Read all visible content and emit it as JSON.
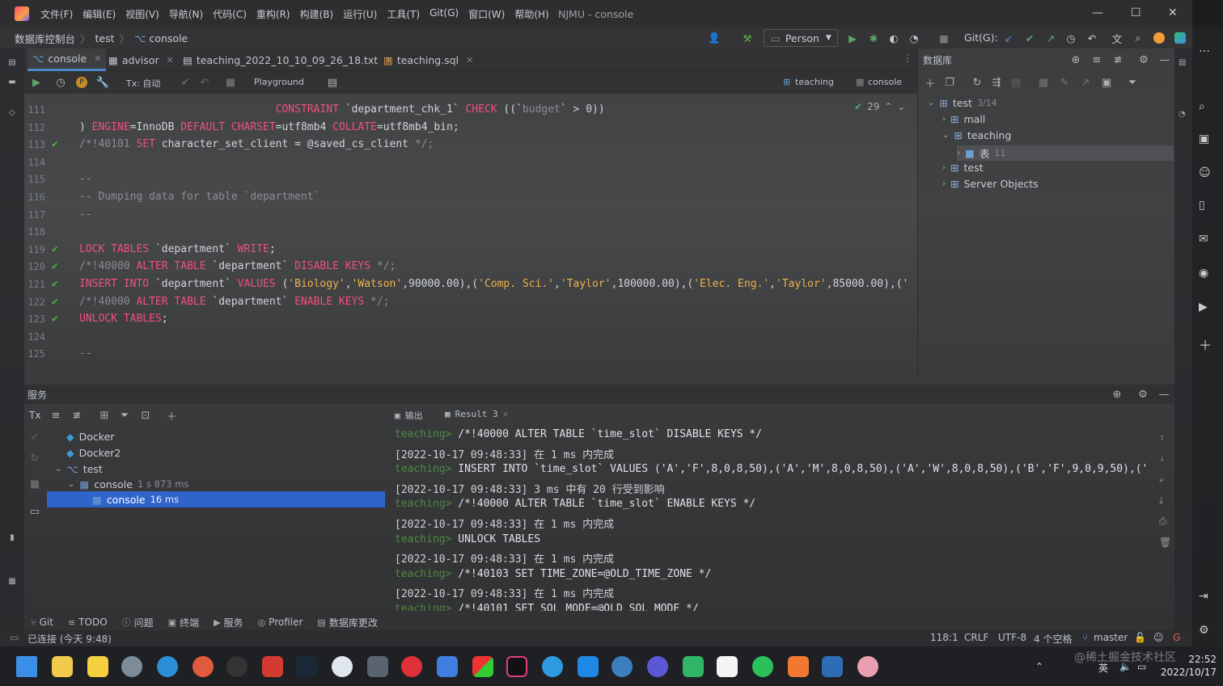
{
  "window": {
    "title": "NJMU - console"
  },
  "menu": [
    "文件(F)",
    "编辑(E)",
    "视图(V)",
    "导航(N)",
    "代码(C)",
    "重构(R)",
    "构建(B)",
    "运行(U)",
    "工具(T)",
    "Git(G)",
    "窗口(W)",
    "帮助(H)"
  ],
  "breadcrumb": {
    "root": "数据库控制台",
    "db": "test",
    "file": "console"
  },
  "toolbar": {
    "run_config": "Person",
    "git_label": "Git(G):"
  },
  "tabs": [
    {
      "label": "console"
    },
    {
      "label": "advisor"
    },
    {
      "label": "teaching_2022_10_10_09_26_18.txt"
    },
    {
      "label": "teaching.sql"
    }
  ],
  "editor_toolbar": {
    "tx": "Tx: 自动",
    "playground": "Playground",
    "schema": "teaching",
    "session": "console"
  },
  "inspection": {
    "count": "29"
  },
  "code": {
    "lines": [
      {
        "n": "111",
        "chk": false,
        "parts": [
          {
            "t": "                               ",
            "c": ""
          },
          {
            "t": "CONSTRAINT",
            "c": "kw"
          },
          {
            "t": " `department_chk_1` ",
            "c": ""
          },
          {
            "t": "CHECK",
            "c": "kw"
          },
          {
            "t": " ((`",
            "c": ""
          },
          {
            "t": "budget",
            "c": "com"
          },
          {
            "t": "` > 0))",
            "c": ""
          }
        ]
      },
      {
        "n": "112",
        "chk": false,
        "parts": [
          {
            "t": ") ",
            "c": ""
          },
          {
            "t": "ENGINE",
            "c": "kw"
          },
          {
            "t": "=InnoDB ",
            "c": ""
          },
          {
            "t": "DEFAULT CHARSET",
            "c": "kw"
          },
          {
            "t": "=utf8mb4 ",
            "c": ""
          },
          {
            "t": "COLLATE",
            "c": "kw"
          },
          {
            "t": "=utf8mb4_bin;",
            "c": ""
          }
        ]
      },
      {
        "n": "113",
        "chk": true,
        "parts": [
          {
            "t": "/*!40101 ",
            "c": "com"
          },
          {
            "t": "SET",
            "c": "kw"
          },
          {
            "t": " character_set_client = @saved_cs_client ",
            "c": ""
          },
          {
            "t": "*/;",
            "c": "com"
          }
        ]
      },
      {
        "n": "114",
        "chk": false,
        "parts": []
      },
      {
        "n": "115",
        "chk": false,
        "parts": [
          {
            "t": "--",
            "c": "com"
          }
        ]
      },
      {
        "n": "116",
        "chk": false,
        "parts": [
          {
            "t": "-- Dumping data for table `department`",
            "c": "com"
          }
        ]
      },
      {
        "n": "117",
        "chk": false,
        "parts": [
          {
            "t": "--",
            "c": "com"
          }
        ]
      },
      {
        "n": "118",
        "chk": false,
        "parts": []
      },
      {
        "n": "119",
        "chk": true,
        "parts": [
          {
            "t": "LOCK TABLES",
            "c": "kw"
          },
          {
            "t": " `department` ",
            "c": ""
          },
          {
            "t": "WRITE",
            "c": "kw"
          },
          {
            "t": ";",
            "c": ""
          }
        ]
      },
      {
        "n": "120",
        "chk": true,
        "parts": [
          {
            "t": "/*!40000 ",
            "c": "com"
          },
          {
            "t": "ALTER TABLE",
            "c": "kw"
          },
          {
            "t": " `department` ",
            "c": ""
          },
          {
            "t": "DISABLE KEYS",
            "c": "kw"
          },
          {
            "t": " */;",
            "c": "com"
          }
        ]
      },
      {
        "n": "121",
        "chk": true,
        "parts": [
          {
            "t": "INSERT INTO",
            "c": "kw"
          },
          {
            "t": " `department` ",
            "c": ""
          },
          {
            "t": "VALUES",
            "c": "kw"
          },
          {
            "t": " (",
            "c": ""
          },
          {
            "t": "'Biology'",
            "c": "str"
          },
          {
            "t": ",",
            "c": ""
          },
          {
            "t": "'Watson'",
            "c": "str"
          },
          {
            "t": ",90000.00),(",
            "c": ""
          },
          {
            "t": "'Comp. Sci.'",
            "c": "str"
          },
          {
            "t": ",",
            "c": ""
          },
          {
            "t": "'Taylor'",
            "c": "str"
          },
          {
            "t": ",100000.00),(",
            "c": ""
          },
          {
            "t": "'Elec. Eng.'",
            "c": "str"
          },
          {
            "t": ",",
            "c": ""
          },
          {
            "t": "'Taylor'",
            "c": "str"
          },
          {
            "t": ",85000.00),('",
            "c": ""
          }
        ]
      },
      {
        "n": "122",
        "chk": true,
        "parts": [
          {
            "t": "/*!40000 ",
            "c": "com"
          },
          {
            "t": "ALTER TABLE",
            "c": "kw"
          },
          {
            "t": " `department` ",
            "c": ""
          },
          {
            "t": "ENABLE KEYS",
            "c": "kw"
          },
          {
            "t": " */;",
            "c": "com"
          }
        ]
      },
      {
        "n": "123",
        "chk": true,
        "parts": [
          {
            "t": "UNLOCK TABLES",
            "c": "kw"
          },
          {
            "t": ";",
            "c": ""
          }
        ]
      },
      {
        "n": "124",
        "chk": false,
        "parts": []
      },
      {
        "n": "125",
        "chk": false,
        "parts": [
          {
            "t": "--",
            "c": "com"
          }
        ]
      }
    ]
  },
  "db_panel": {
    "title": "数据库",
    "tree": [
      {
        "label": "test",
        "extra": "3/14",
        "level": 0,
        "arrow": "v"
      },
      {
        "label": "mall",
        "extra": "",
        "level": 1,
        "arrow": ">"
      },
      {
        "label": "teaching",
        "extra": "",
        "level": 1,
        "arrow": "v"
      },
      {
        "label": "表",
        "extra": "11",
        "level": 2,
        "arrow": ">"
      },
      {
        "label": "test",
        "extra": "",
        "level": 1,
        "arrow": ">"
      },
      {
        "label": "Server Objects",
        "extra": "",
        "level": 1,
        "arrow": ">"
      }
    ]
  },
  "services": {
    "title": "服务",
    "tx": "Tx",
    "tree": [
      {
        "label": "Docker",
        "extra": "",
        "level": 1
      },
      {
        "label": "Docker2",
        "extra": "",
        "level": 1
      },
      {
        "label": "test",
        "extra": "",
        "level": 1
      },
      {
        "label": "console",
        "extra": "1 s 873 ms",
        "level": 2
      },
      {
        "label": "console",
        "extra": "16 ms",
        "level": 3
      }
    ],
    "output_tabs": [
      "输出",
      "Result 3"
    ],
    "output": [
      {
        "prompt": "teaching>",
        "text": " /*!40000 ALTER TABLE `time_slot` DISABLE KEYS */"
      },
      {
        "prompt": "",
        "text": "[2022-10-17 09:48:33] 在 1 ms 内完成"
      },
      {
        "prompt": "teaching>",
        "text": " INSERT INTO `time_slot` VALUES ('A','F',8,0,8,50),('A','M',8,0,8,50),('A','W',8,0,8,50),('B','F',9,0,9,50),('"
      },
      {
        "prompt": "",
        "text": "[2022-10-17 09:48:33] 3 ms 中有 20 行受到影响"
      },
      {
        "prompt": "teaching>",
        "text": " /*!40000 ALTER TABLE `time_slot` ENABLE KEYS */"
      },
      {
        "prompt": "",
        "text": "[2022-10-17 09:48:33] 在 1 ms 内完成"
      },
      {
        "prompt": "teaching>",
        "text": " UNLOCK TABLES"
      },
      {
        "prompt": "",
        "text": "[2022-10-17 09:48:33] 在 1 ms 内完成"
      },
      {
        "prompt": "teaching>",
        "text": " /*!40103 SET TIME_ZONE=@OLD_TIME_ZONE */"
      },
      {
        "prompt": "",
        "text": "[2022-10-17 09:48:33] 在 1 ms 内完成"
      },
      {
        "prompt": "teaching>",
        "text": " /*!40101 SET SQL_MODE=@OLD_SQL_MODE */"
      }
    ]
  },
  "bottom_tabs": [
    "Git",
    "TODO",
    "问题",
    "终端",
    "服务",
    "Profiler",
    "数据库更改"
  ],
  "status": {
    "left": "已连接 (今天 9:48)",
    "pos": "118:1",
    "eol": "CRLF",
    "enc": "UTF-8",
    "indent": "4 个空格",
    "branch": "master"
  },
  "taskbar": {
    "time": "22:52",
    "date": "2022/10/17",
    "ime": "英"
  },
  "watermark": "@稀土掘金技术社区"
}
